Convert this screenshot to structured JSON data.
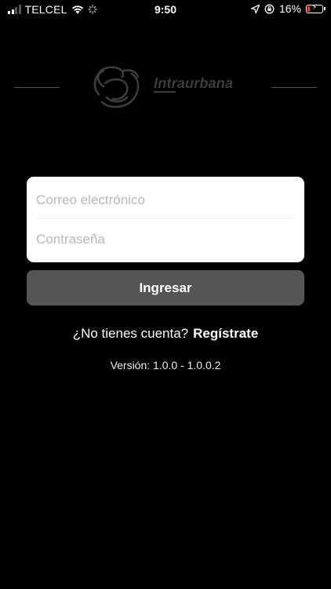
{
  "status_bar": {
    "carrier": "TELCEL",
    "time": "9:50",
    "battery_text": "16%",
    "battery_level": 0.16,
    "icons": [
      "signal-icon",
      "wifi-icon",
      "loading-icon",
      "location-arrow-icon",
      "orientation-lock-icon",
      "battery-charging-icon"
    ]
  },
  "logo": {
    "brand": "Intraurbana",
    "icon": "intraurbana-logo-icon",
    "color": "#3c3c3c"
  },
  "form": {
    "email_placeholder": "Correo electrónico",
    "password_placeholder": "Contraseña",
    "submit_label": "Ingresar"
  },
  "signup": {
    "prompt": "¿No tienes cuenta?",
    "link_label": "Regístrate"
  },
  "version": "Versión: 1.0.0 - 1.0.0.2",
  "colors": {
    "background": "#000000",
    "card": "#ffffff",
    "button": "#555555",
    "battery_low": "#ff3b30"
  }
}
